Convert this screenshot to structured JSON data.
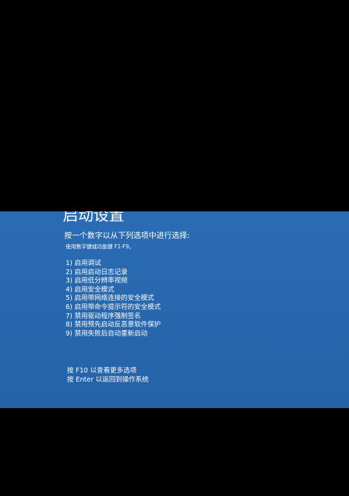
{
  "screen": {
    "title": "启动设置",
    "prompt": "按一个数字以从下列选项中进行选择:",
    "hint": "使用数字键或功能键 F1-F9。",
    "options": [
      "1) 启用调试",
      "2) 启用启动日志记录",
      "3) 启用低分辨率视频",
      "4) 启用安全模式",
      "5) 启用带网络连接的安全模式",
      "6) 启用带命令提示符的安全模式",
      "7) 禁用驱动程序强制签名",
      "8) 禁用预先启动反恶意软件保护",
      "9) 禁用失败后自动重新启动"
    ],
    "footer": {
      "more_options": "按 F10 以查看更多选项",
      "return": "按 Enter 以返回到操作系统"
    }
  },
  "colors": {
    "screen_background": "#2767ad",
    "text": "#ffffff",
    "letterbox": "#000000"
  }
}
